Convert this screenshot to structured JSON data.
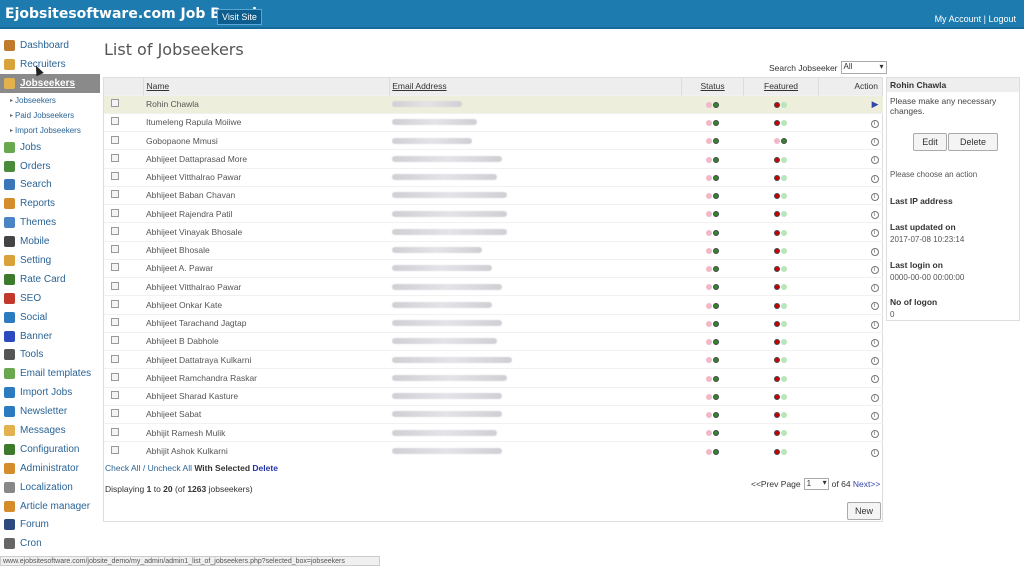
{
  "header": {
    "brand": "Ejobsitesoftware.com Job Board",
    "visit_site": "Visit Site",
    "my_account": "My Account",
    "separator": "|",
    "logout": "Logout"
  },
  "sidebar": {
    "items": [
      {
        "label": "Dashboard",
        "icon": "home-icon",
        "color": "#c07a2c"
      },
      {
        "label": "Recruiters",
        "icon": "user-icon",
        "color": "#d9a23a"
      },
      {
        "label": "Jobseekers",
        "icon": "users-icon",
        "color": "#e3b14d",
        "active": true
      },
      {
        "label": "Jobs",
        "icon": "people-icon",
        "color": "#6aa84f"
      },
      {
        "label": "Orders",
        "icon": "cart-icon",
        "color": "#4a8b3b"
      },
      {
        "label": "Search",
        "icon": "search-icon",
        "color": "#3a76b8"
      },
      {
        "label": "Reports",
        "icon": "book-icon",
        "color": "#d58c2b"
      },
      {
        "label": "Themes",
        "icon": "grid-icon",
        "color": "#4a84c4"
      },
      {
        "label": "Mobile",
        "icon": "mobile-icon",
        "color": "#444444"
      },
      {
        "label": "Setting",
        "icon": "gear-icon",
        "color": "#d9a23a"
      },
      {
        "label": "Rate Card",
        "icon": "dollar-icon",
        "color": "#3d7a2c"
      },
      {
        "label": "SEO",
        "icon": "chart-icon",
        "color": "#c0392b"
      },
      {
        "label": "Social",
        "icon": "globe-icon",
        "color": "#2c7ac0"
      },
      {
        "label": "Banner",
        "icon": "banner-icon",
        "color": "#2c4ac0"
      },
      {
        "label": "Tools",
        "icon": "tools-icon",
        "color": "#555555"
      },
      {
        "label": "Email templates",
        "icon": "email-icon",
        "color": "#6aa84f"
      },
      {
        "label": "Import Jobs",
        "icon": "import-icon",
        "color": "#2c7ac0"
      },
      {
        "label": "Newsletter",
        "icon": "newsletter-icon",
        "color": "#2c7ac0"
      },
      {
        "label": "Messages",
        "icon": "message-icon",
        "color": "#e3b14d"
      },
      {
        "label": "Configuration",
        "icon": "config-icon",
        "color": "#3d7a2c"
      },
      {
        "label": "Administrator",
        "icon": "admin-icon",
        "color": "#d58c2b"
      },
      {
        "label": "Localization",
        "icon": "clock-icon",
        "color": "#888888"
      },
      {
        "label": "Article manager",
        "icon": "article-icon",
        "color": "#d58c2b"
      },
      {
        "label": "Forum",
        "icon": "forum-icon",
        "color": "#2c4a80"
      },
      {
        "label": "Cron",
        "icon": "cron-icon",
        "color": "#666666"
      }
    ],
    "subitems": [
      "Jobseekers",
      "Paid Jobseekers",
      "Import Jobseekers"
    ]
  },
  "main": {
    "title": "List of Jobseekers",
    "search_label": "Search Jobseeker",
    "search_value": "All",
    "columns": [
      "Name",
      "Email Address",
      "Status",
      "Featured",
      "Action"
    ],
    "rows": [
      {
        "name": "Rohin Chawla",
        "email_width": 70,
        "featured_first": true,
        "highlight": true
      },
      {
        "name": "Itumeleng Rapula Moiiwe",
        "email_width": 85,
        "featured_first": true
      },
      {
        "name": "Gobopaone Mmusi",
        "email_width": 80,
        "featured_first": false
      },
      {
        "name": "Abhijeet Dattaprasad More",
        "email_width": 110,
        "featured_first": true
      },
      {
        "name": "Abhijeet Vitthalrao Pawar",
        "email_width": 105,
        "featured_first": true
      },
      {
        "name": "Abhijeet Baban Chavan",
        "email_width": 115,
        "featured_first": true
      },
      {
        "name": "Abhijeet Rajendra Patil",
        "email_width": 115,
        "featured_first": true
      },
      {
        "name": "Abhijeet Vinayak Bhosale",
        "email_width": 115,
        "featured_first": true
      },
      {
        "name": "Abhijeet Bhosale",
        "email_width": 90,
        "featured_first": true
      },
      {
        "name": "Abhijeet A. Pawar",
        "email_width": 100,
        "featured_first": true
      },
      {
        "name": "Abhijeet Vitthalrao Pawar",
        "email_width": 110,
        "featured_first": true
      },
      {
        "name": "Abhijeet Onkar Kate",
        "email_width": 100,
        "featured_first": true
      },
      {
        "name": "Abhijeet Tarachand Jagtap",
        "email_width": 110,
        "featured_first": true
      },
      {
        "name": "Abhijeet B Dabhole",
        "email_width": 105,
        "featured_first": true
      },
      {
        "name": "Abhijeet Dattatraya Kulkarni",
        "email_width": 120,
        "featured_first": true
      },
      {
        "name": "Abhijeet Ramchandra Raskar",
        "email_width": 115,
        "featured_first": true
      },
      {
        "name": "Abhijeet Sharad Kasture",
        "email_width": 110,
        "featured_first": true
      },
      {
        "name": "Abhijeet Sabat",
        "email_width": 110,
        "featured_first": true
      },
      {
        "name": "Abhijit Ramesh Mulik",
        "email_width": 105,
        "featured_first": true
      },
      {
        "name": "Abhijit Ashok Kulkarni",
        "email_width": 110,
        "featured_first": true
      }
    ],
    "check_all": "Check All",
    "slash": "/",
    "uncheck_all": "Uncheck All",
    "with_selected": "With Selected",
    "delete": "Delete",
    "displaying": "Displaying",
    "from": "1",
    "to_word": "to",
    "to": "20",
    "of_word": "(of",
    "total": "1263",
    "suffix": "jobseekers)",
    "prev": "<<Prev",
    "page_label": "Page",
    "page_value": "1",
    "of_pages": "of 64",
    "next": "Next>>",
    "new_button": "New"
  },
  "panel": {
    "title": "Rohin Chawla",
    "message": "Please make any necessary changes.",
    "edit": "Edit",
    "delete": "Delete",
    "choose": "Please choose an action",
    "ip_label": "Last IP address",
    "updated_label": "Last updated on",
    "updated_value": "2017-07-08 10:23:14",
    "login_label": "Last login on",
    "login_value": "0000-00-00 00:00:00",
    "logon_label": "No of logon",
    "logon_value": "0"
  },
  "statusbar": {
    "url": "www.ejobsitesoftware.com/jobsite_demo/my_admin/admin1_list_of_jobseekers.php?selected_box=jobseekers"
  }
}
